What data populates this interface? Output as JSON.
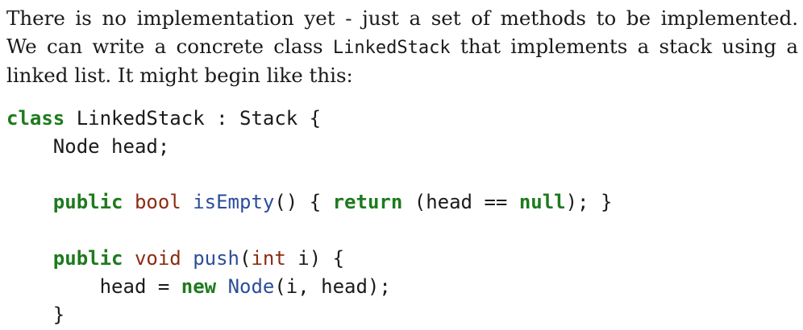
{
  "paragraph": {
    "line1": "There is no implementation yet - just a set of methods to be implemented.",
    "line2_before": "We can write a concrete class ",
    "line2_code": "LinkedStack",
    "line2_after": " that implements a stack using a",
    "line3": "linked list. It might begin like this:"
  },
  "code": {
    "l1": {
      "kw": "class",
      "rest": " LinkedStack : Stack {"
    },
    "l2": {
      "indent": "    ",
      "text": "Node head;"
    },
    "l4": {
      "indent": "    ",
      "kw1": "public",
      "sp1": " ",
      "ty1": "bool",
      "sp2": " ",
      "fn1": "isEmpty",
      "t1": "() { ",
      "kw2": "return",
      "t2": " (head == ",
      "kw3": "null",
      "t3": "); }"
    },
    "l6": {
      "indent": "    ",
      "kw1": "public",
      "sp1": " ",
      "ty1": "void",
      "sp2": " ",
      "fn1": "push",
      "t1": "(",
      "ty2": "int",
      "t2": " i) {"
    },
    "l7": {
      "indent": "        ",
      "t1": "head = ",
      "kw1": "new",
      "sp1": " ",
      "fn1": "Node",
      "t2": "(i, head);"
    },
    "l8": {
      "indent": "    ",
      "text": "}"
    }
  }
}
